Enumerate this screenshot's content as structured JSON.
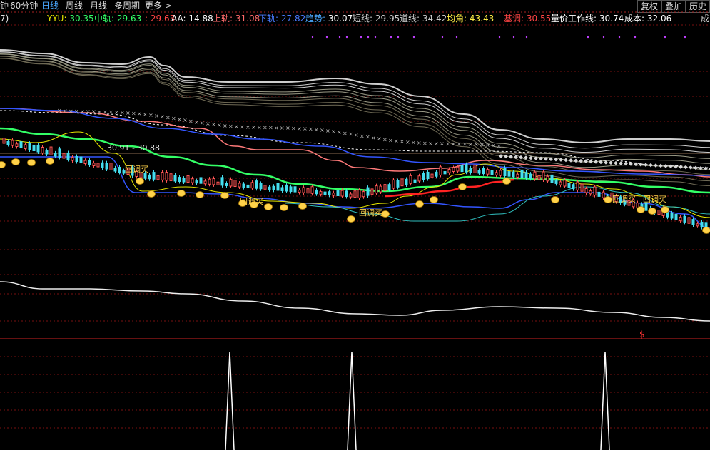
{
  "toolbar": {
    "first_fragment": "钟",
    "periods": [
      {
        "label": "60分钟",
        "active": false
      },
      {
        "label": "日线",
        "active": true
      },
      {
        "label": "周线",
        "active": false
      },
      {
        "label": "月线",
        "active": false
      },
      {
        "label": "多周期",
        "active": false
      },
      {
        "label": "更多 >",
        "active": false
      }
    ],
    "right_buttons": [
      "复权",
      "叠加",
      "历史"
    ]
  },
  "legend": {
    "prefix": "7)",
    "items": [
      {
        "name": "YYU",
        "value": "30.35",
        "color": "#e8e800",
        "value_color": "#33ff66"
      },
      {
        "name": "中轨",
        "value": "29.63",
        "color": "#33ff66",
        "value_color": "#33ff66"
      },
      {
        "name": "",
        "value": "29.63",
        "color": "#ff4444",
        "value_color": "#ff4444"
      },
      {
        "name": "AA",
        "value": "14.88",
        "color": "#ffffff",
        "value_color": "#ffffff"
      },
      {
        "name": "上轨",
        "value": "31.08",
        "color": "#ff6b6b",
        "value_color": "#ff6b6b"
      },
      {
        "name": "下轨",
        "value": "27.82",
        "color": "#4a7bff",
        "value_color": "#4a7bff"
      },
      {
        "name": "趋势",
        "value": "30.07",
        "color": "#4aa8ff",
        "value_color": "#ffffff"
      },
      {
        "name": "短线",
        "value": "29.95",
        "color": "#cccccc",
        "value_color": "#cccccc"
      },
      {
        "name": "道线",
        "value": "34.42",
        "color": "#cccccc",
        "value_color": "#cccccc"
      },
      {
        "name": "均角",
        "value": "43.43",
        "color": "#ffee44",
        "value_color": "#ffee44"
      },
      {
        "name": "基调",
        "value": "30.55",
        "color": "#ff4444",
        "value_color": "#ff4444"
      },
      {
        "name": "量价工作线",
        "value": "30.74",
        "color": "#ffffff",
        "value_color": "#ffffff"
      },
      {
        "name": "成本",
        "value": "32.06",
        "color": "#ffffff",
        "value_color": "#ffffff"
      }
    ],
    "edge_fragment": "成"
  },
  "annotations": {
    "price_range": "30.91 - 30.88",
    "signal_label": "回调买",
    "marker": "$"
  },
  "colors": {
    "background": "#000000",
    "grid": "#7a1010",
    "ribbon": "#a8a8a8",
    "mid_band": "#33ff66",
    "upper_band": "#ff7a7a",
    "lower_band": "#3355ff",
    "trend": "#ff2222",
    "coin": "#ffd24a",
    "spike": "#ffffff"
  }
}
